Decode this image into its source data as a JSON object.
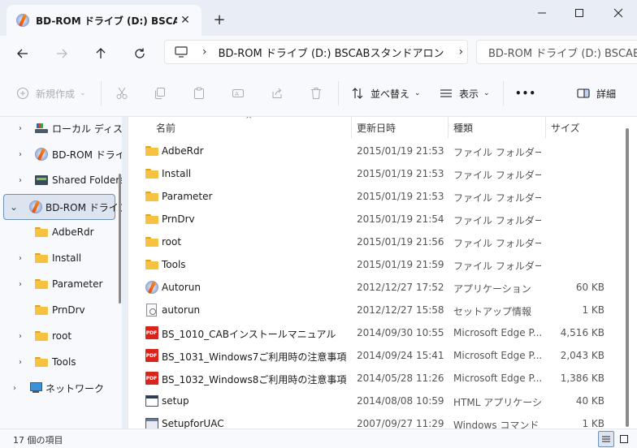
{
  "window": {
    "tab_title": "BD-ROM ドライブ (D:) BSCABスタ",
    "close_glyph": "✕",
    "new_tab_glyph": "+"
  },
  "address": {
    "path": "BD-ROM ドライブ (D:) BSCABスタンドアロン",
    "search_placeholder": "BD-ROM ドライブ (D:) BSCABスタン"
  },
  "toolbar": {
    "new_label": "新規作成",
    "sort_label": "並べ替え",
    "view_label": "表示",
    "more_label": "•••",
    "details_label": "詳細"
  },
  "sidebar": {
    "items": [
      {
        "label": "ローカル ディスク",
        "icon": "drive-icon",
        "expand": "›"
      },
      {
        "label": "BD-ROM ドライブ",
        "icon": "bd-rom-icon",
        "expand": "›"
      },
      {
        "label": "Shared Folders",
        "icon": "shared-folder-icon",
        "expand": "›"
      },
      {
        "label": "BD-ROM ドライブ",
        "icon": "bd-rom-icon",
        "expand": "⌄"
      },
      {
        "label": "AdbeRdr",
        "icon": "folder-icon",
        "expand": ""
      },
      {
        "label": "Install",
        "icon": "folder-icon",
        "expand": "›"
      },
      {
        "label": "Parameter",
        "icon": "folder-icon",
        "expand": "›"
      },
      {
        "label": "PrnDrv",
        "icon": "folder-icon",
        "expand": ""
      },
      {
        "label": "root",
        "icon": "folder-icon",
        "expand": "›"
      },
      {
        "label": "Tools",
        "icon": "folder-icon",
        "expand": "›"
      },
      {
        "label": "ネットワーク",
        "icon": "network-icon",
        "expand": "›"
      }
    ]
  },
  "columns": {
    "name": "名前",
    "date": "更新日時",
    "type": "種類",
    "size": "サイズ"
  },
  "files": [
    {
      "name": "AdbeRdr",
      "date": "2015/01/19 21:53",
      "type": "ファイル フォルダー",
      "size": "",
      "icon": "folder-icon"
    },
    {
      "name": "Install",
      "date": "2015/01/19 21:53",
      "type": "ファイル フォルダー",
      "size": "",
      "icon": "folder-icon"
    },
    {
      "name": "Parameter",
      "date": "2015/01/19 21:53",
      "type": "ファイル フォルダー",
      "size": "",
      "icon": "folder-icon"
    },
    {
      "name": "PrnDrv",
      "date": "2015/01/19 21:54",
      "type": "ファイル フォルダー",
      "size": "",
      "icon": "folder-icon"
    },
    {
      "name": "root",
      "date": "2015/01/19 21:56",
      "type": "ファイル フォルダー",
      "size": "",
      "icon": "folder-icon"
    },
    {
      "name": "Tools",
      "date": "2015/01/19 21:59",
      "type": "ファイル フォルダー",
      "size": "",
      "icon": "folder-icon"
    },
    {
      "name": "Autorun",
      "date": "2012/12/27 17:52",
      "type": "アプリケーション",
      "size": "60 KB",
      "icon": "app-icon"
    },
    {
      "name": "autorun",
      "date": "2012/12/27 15:58",
      "type": "セットアップ情報",
      "size": "1 KB",
      "icon": "setup-info-icon"
    },
    {
      "name": "BS_1010_CABインストールマニュアル",
      "date": "2014/09/30 10:55",
      "type": "Microsoft Edge P...",
      "size": "4,516 KB",
      "icon": "pdf-icon"
    },
    {
      "name": "BS_1031_Windows7ご利用時の注意事項",
      "date": "2014/09/24 15:41",
      "type": "Microsoft Edge P...",
      "size": "2,043 KB",
      "icon": "pdf-icon"
    },
    {
      "name": "BS_1032_Windows8ご利用時の注意事項",
      "date": "2014/05/28 11:26",
      "type": "Microsoft Edge P...",
      "size": "1,386 KB",
      "icon": "pdf-icon"
    },
    {
      "name": "setup",
      "date": "2014/08/08 10:59",
      "type": "HTML アプリケーション",
      "size": "40 KB",
      "icon": "hta-icon"
    },
    {
      "name": "SetupforUAC",
      "date": "2007/09/27 11:29",
      "type": "Windows コマンド ...",
      "size": "1 KB",
      "icon": "cmd-icon"
    }
  ],
  "status": {
    "item_count": "17 個の項目"
  },
  "pdf_badge": "PDF"
}
